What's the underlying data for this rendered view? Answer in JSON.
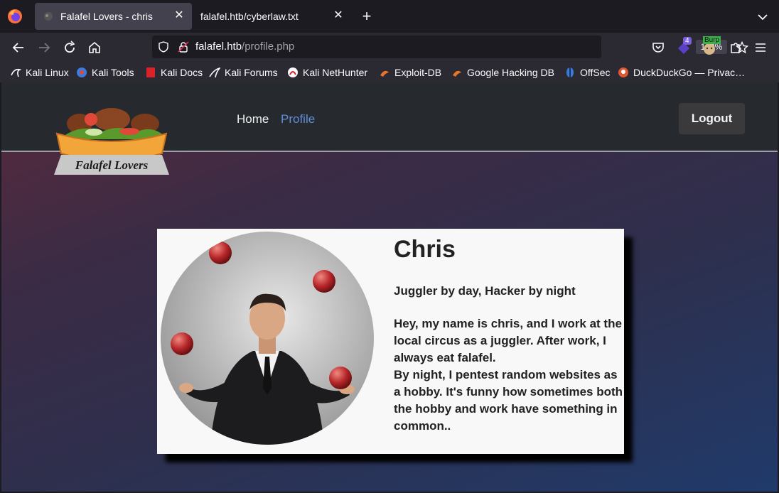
{
  "browser": {
    "tabs": [
      {
        "title": "Falafel Lovers - chris",
        "active": true
      },
      {
        "title": "falafel.htb/cyberlaw.txt",
        "active": false
      }
    ],
    "url_host": "falafel.htb",
    "url_path": "/profile.php",
    "zoom": "120%",
    "extension_badge": "4",
    "burp_label": "Burp",
    "bookmarks": [
      "Kali Linux",
      "Kali Tools",
      "Kali Docs",
      "Kali Forums",
      "Kali NetHunter",
      "Exploit-DB",
      "Google Hacking DB",
      "OffSec",
      "DuckDuckGo — Privac…"
    ]
  },
  "site": {
    "logo_text": "Falafel Lovers",
    "nav": {
      "home": "Home",
      "profile": "Profile"
    },
    "logout_label": "Logout"
  },
  "profile": {
    "name": "Chris",
    "tagline": "Juggler by day, Hacker by night",
    "bio_1": "Hey, my name is chris, and I work at the local circus as a juggler. After work, I always eat falafel.",
    "bio_2": "By night, I pentest random websites as a hobby. It's funny how sometimes both the hobby and work have something in common.."
  }
}
